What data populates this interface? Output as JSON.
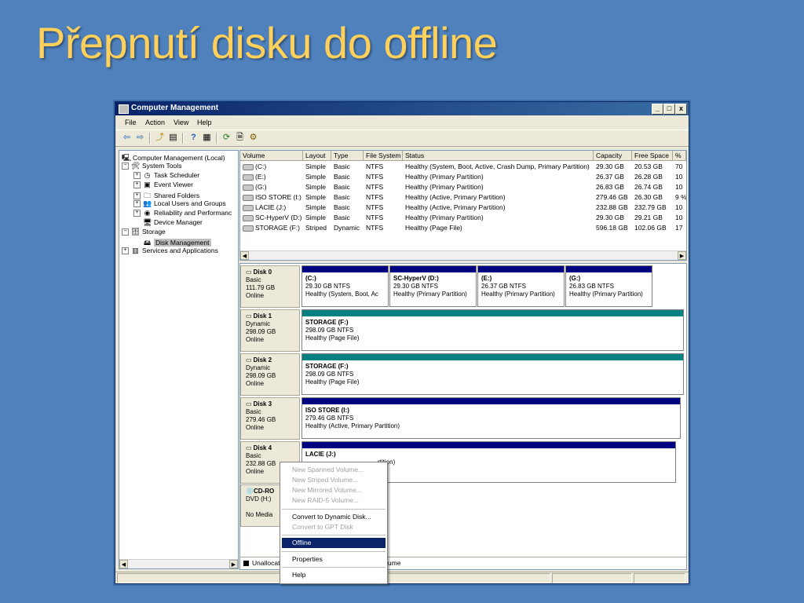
{
  "slide": {
    "title": "Přepnutí disku do offline"
  },
  "window": {
    "title": "Computer Management",
    "buttons": {
      "minimize": "_",
      "maximize": "□",
      "close": "x"
    }
  },
  "menu": [
    "File",
    "Action",
    "View",
    "Help"
  ],
  "toolbar": {
    "icons": [
      "back-arrow-icon",
      "forward-arrow-icon",
      "up-folder-icon",
      "show-hide-tree-icon",
      "help-icon",
      "properties-icon",
      "refresh-icon",
      "export-icon",
      "settings-icon"
    ]
  },
  "tree": {
    "items": [
      {
        "label": "Computer Management (Local)",
        "icon": "computer-icon",
        "expander": ""
      },
      {
        "label": "System Tools",
        "icon": "tools-icon",
        "expander": "−"
      },
      {
        "label": "Task Scheduler",
        "icon": "clock-icon",
        "expander": "+"
      },
      {
        "label": "Event Viewer",
        "icon": "event-viewer-icon",
        "expander": "+"
      },
      {
        "label": "Shared Folders",
        "icon": "shared-folders-icon",
        "expander": "+"
      },
      {
        "label": "Local Users and Groups",
        "icon": "users-icon",
        "expander": "+"
      },
      {
        "label": "Reliability and Performanc",
        "icon": "performance-icon",
        "expander": "+"
      },
      {
        "label": "Device Manager",
        "icon": "device-manager-icon",
        "expander": ""
      },
      {
        "label": "Storage",
        "icon": "storage-icon",
        "expander": "−"
      },
      {
        "label": "Disk Management",
        "icon": "disk-management-icon",
        "expander": ""
      },
      {
        "label": "Services and Applications",
        "icon": "services-icon",
        "expander": "+"
      }
    ]
  },
  "volumes": {
    "columns": [
      "Volume",
      "Layout",
      "Type",
      "File System",
      "Status",
      "Capacity",
      "Free Space",
      "%"
    ],
    "rows": [
      [
        "(C:)",
        "Simple",
        "Basic",
        "NTFS",
        "Healthy (System, Boot, Active, Crash Dump, Primary Partition)",
        "29.30 GB",
        "20.53 GB",
        "70"
      ],
      [
        "(E:)",
        "Simple",
        "Basic",
        "NTFS",
        "Healthy (Primary Partition)",
        "26.37 GB",
        "26.28 GB",
        "10"
      ],
      [
        "(G:)",
        "Simple",
        "Basic",
        "NTFS",
        "Healthy (Primary Partition)",
        "26.83 GB",
        "26.74 GB",
        "10"
      ],
      [
        "ISO STORE (I:)",
        "Simple",
        "Basic",
        "NTFS",
        "Healthy (Active, Primary Partition)",
        "279.46 GB",
        "26.30 GB",
        "9 %"
      ],
      [
        "LACIE (J:)",
        "Simple",
        "Basic",
        "NTFS",
        "Healthy (Active, Primary Partition)",
        "232.88 GB",
        "232.79 GB",
        "10"
      ],
      [
        "SC-HyperV (D:)",
        "Simple",
        "Basic",
        "NTFS",
        "Healthy (Primary Partition)",
        "29.30 GB",
        "29.21 GB",
        "10"
      ],
      [
        "STORAGE (F:)",
        "Striped",
        "Dynamic",
        "NTFS",
        "Healthy (Page File)",
        "596.18 GB",
        "102.06 GB",
        "17"
      ]
    ]
  },
  "disks": [
    {
      "name": "Disk 0",
      "type": "Basic",
      "size": "111.79 GB",
      "state": "Online",
      "partitions": [
        {
          "name": "(C:)",
          "size": "29.30 GB NTFS",
          "status": "Healthy (System, Boot, Ac",
          "color": "#000080"
        },
        {
          "name": "SC-HyperV  (D:)",
          "size": "29.30 GB NTFS",
          "status": "Healthy (Primary Partition)",
          "color": "#000080"
        },
        {
          "name": "(E:)",
          "size": "26.37 GB NTFS",
          "status": "Healthy (Primary Partition)",
          "color": "#000080"
        },
        {
          "name": "(G:)",
          "size": "26.83 GB NTFS",
          "status": "Healthy (Primary Partition)",
          "color": "#000080"
        }
      ]
    },
    {
      "name": "Disk 1",
      "type": "Dynamic",
      "size": "298.09 GB",
      "state": "Online",
      "partitions": [
        {
          "name": "STORAGE  (F:)",
          "size": "298.09 GB NTFS",
          "status": "Healthy (Page File)",
          "color": "#008080"
        }
      ]
    },
    {
      "name": "Disk 2",
      "type": "Dynamic",
      "size": "298.09 GB",
      "state": "Online",
      "partitions": [
        {
          "name": "STORAGE  (F:)",
          "size": "298.09 GB NTFS",
          "status": "Healthy (Page File)",
          "color": "#008080"
        }
      ]
    },
    {
      "name": "Disk 3",
      "type": "Basic",
      "size": "279.46 GB",
      "state": "Online",
      "partitions": [
        {
          "name": "ISO STORE  (I:)",
          "size": "279.46 GB NTFS",
          "status": "Healthy (Active, Primary Partition)",
          "color": "#000080"
        }
      ]
    },
    {
      "name": "Disk 4",
      "type": "Basic",
      "size": "232.88 GB",
      "state": "Online",
      "partitions": [
        {
          "name": "LACIE  (J:)",
          "size": "",
          "status": "rtition)",
          "color": "#000080"
        }
      ]
    }
  ],
  "cdrom": {
    "name": "CD-RO",
    "drive": "DVD (H:)",
    "media": "No Media"
  },
  "legend": {
    "unallocated": "Unallocat",
    "volume_suffix": "lume"
  },
  "context_menu": {
    "items": [
      {
        "label": "New Spanned Volume...",
        "disabled": true
      },
      {
        "label": "New Striped Volume...",
        "disabled": true
      },
      {
        "label": "New Mirrored Volume...",
        "disabled": true
      },
      {
        "label": "New RAID-5 Volume...",
        "disabled": true
      },
      {
        "label": "Convert to Dynamic Disk...",
        "disabled": false
      },
      {
        "label": "Convert to GPT Disk",
        "disabled": true
      },
      {
        "label": "Offline",
        "disabled": false,
        "highlighted": true
      },
      {
        "label": "Properties",
        "disabled": false
      },
      {
        "label": "Help",
        "disabled": false
      }
    ]
  }
}
